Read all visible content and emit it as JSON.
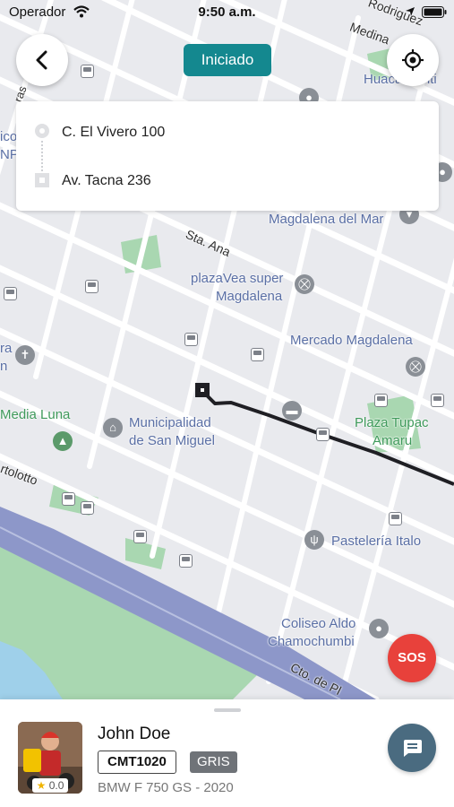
{
  "status_bar": {
    "carrier": "Operador",
    "time": "9:50 a.m."
  },
  "trip": {
    "status": "Iniciado"
  },
  "route": {
    "origin": "C. El Vivero 100",
    "destination": "Av. Tacna 236"
  },
  "map": {
    "labels": {
      "rodriguez": "Rodriguez",
      "medina": "Medina",
      "huaca_santi": "Huaca Santi",
      "magdalena_del_mar": "Magdalena del Mar",
      "sta_ana": "Sta. Ana",
      "plazavea_1": "plazaVea super",
      "plazavea_2": "Magdalena",
      "mercado_magdalena": "Mercado Magdalena",
      "media_luna": "Media Luna",
      "municipalidad_1": "Municipalidad",
      "municipalidad_2": "de San Miguel",
      "plaza_tupac_1": "Plaza Tupac",
      "plaza_tupac_2": "Amaru",
      "pasteleria": "Pastelería Italo",
      "coliseo_1": "Coliseo Aldo",
      "coliseo_2": "Chamochumbi",
      "circuito": "Cto. de Pl",
      "tolotto": "rtolotto",
      "edge_ra": "ra",
      "edge_n": "n",
      "edge_ico": "ico",
      "edge_np": "NP",
      "edge_ras": "ras"
    }
  },
  "sos_label": "SOS",
  "driver": {
    "name": "John Doe",
    "plate": "CMT1020",
    "color": "GRIS",
    "vehicle": "BMW F 750 GS - 2020",
    "rating": "0.0"
  },
  "colors": {
    "teal": "#14888f",
    "sos": "#e8413b",
    "route": "#1f1f24",
    "chat": "#4a6b80"
  }
}
